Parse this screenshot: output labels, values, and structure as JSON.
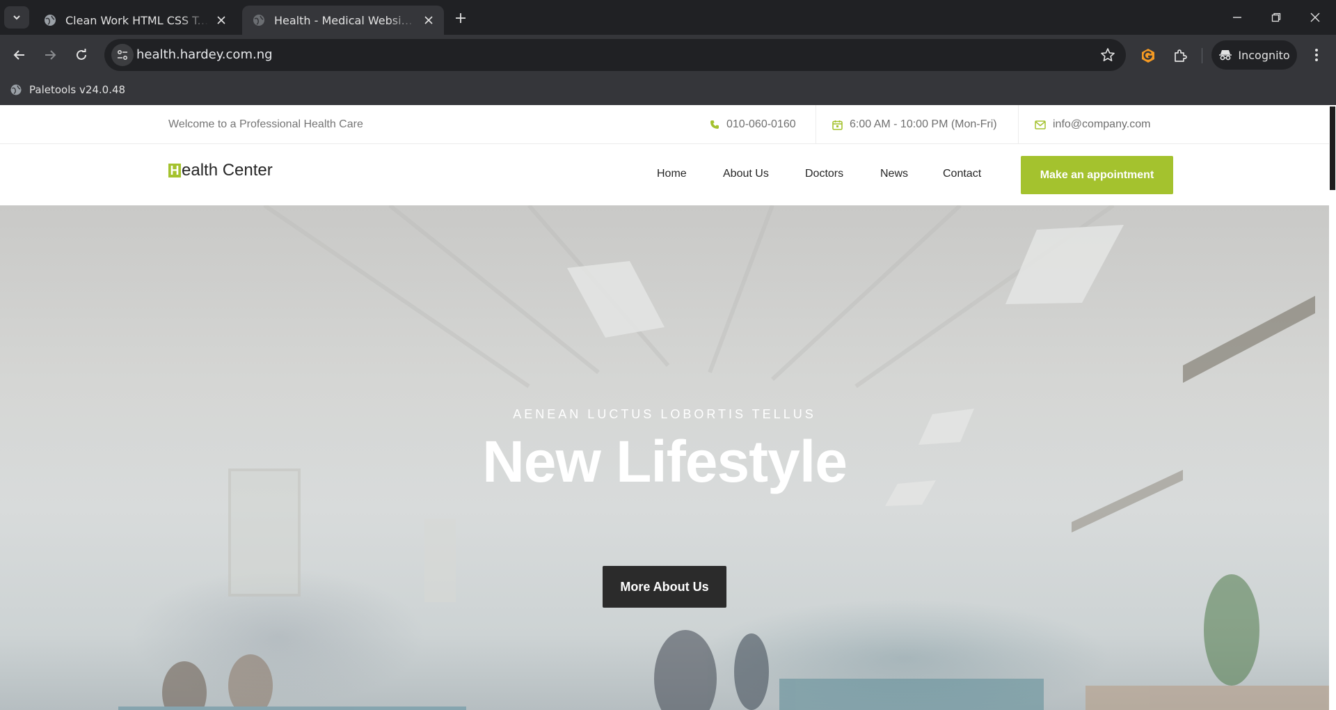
{
  "browser": {
    "tabs": [
      {
        "title": "Clean Work HTML CSS Template",
        "active": false
      },
      {
        "title": "Health - Medical Website Template",
        "active": true
      }
    ],
    "url": "health.hardey.com.ng",
    "incognito_label": "Incognito",
    "bookmark": "Paletools v24.0.48"
  },
  "topbar": {
    "welcome": "Welcome to a Professional Health Care",
    "phone": "010-060-0160",
    "hours": "6:00 AM - 10:00 PM (Mon-Fri)",
    "email": "info@company.com"
  },
  "nav": {
    "logo_letter": "H",
    "logo_rest": "ealth Center",
    "items": [
      "Home",
      "About Us",
      "Doctors",
      "News",
      "Contact"
    ],
    "cta": "Make an appointment"
  },
  "hero": {
    "kicker": "AENEAN LUCTUS LOBORTIS TELLUS",
    "title": "New Lifestyle",
    "button": "More About Us"
  },
  "colors": {
    "accent": "#a4c22e",
    "dark_button": "#2b2b2b"
  }
}
